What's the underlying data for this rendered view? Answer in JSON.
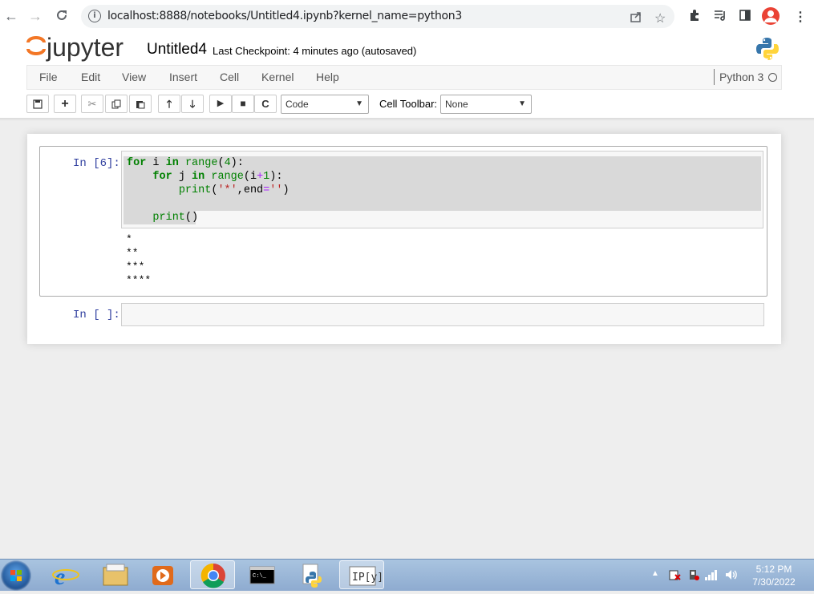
{
  "browser": {
    "url": "localhost:8888/notebooks/Untitled4.ipynb?kernel_name=python3",
    "icons": [
      "back-icon",
      "forward-icon",
      "reload-icon",
      "info-icon",
      "share-icon",
      "star-icon",
      "extensions-icon",
      "reading-list-icon",
      "side-panel-icon",
      "profile-avatar",
      "kebab-menu-icon"
    ]
  },
  "jupyter": {
    "logo_text": "jupyter",
    "notebook_title": "Untitled4",
    "checkpoint": "Last Checkpoint: 4 minutes ago (autosaved)",
    "menu": [
      "File",
      "Edit",
      "View",
      "Insert",
      "Cell",
      "Kernel",
      "Help"
    ],
    "kernel_name": "Python 3",
    "cell_type": "Code",
    "cell_toolbar_label": "Cell Toolbar:",
    "cell_toolbar_value": "None"
  },
  "cells": [
    {
      "prompt": "In [6]:",
      "code": [
        "for i in range(4):",
        "    for j in range(i+1):",
        "        print('*',end='')",
        "",
        "    print()"
      ],
      "output": [
        "*",
        "**",
        "***",
        "****"
      ]
    },
    {
      "prompt": "In [ ]:",
      "code": []
    }
  ],
  "taskbar": {
    "time": "5:12 PM",
    "date": "7/30/2022",
    "apps": [
      "windows-start",
      "internet-explorer",
      "file-explorer",
      "media-player",
      "chrome",
      "command-prompt",
      "python",
      "ipython"
    ]
  }
}
